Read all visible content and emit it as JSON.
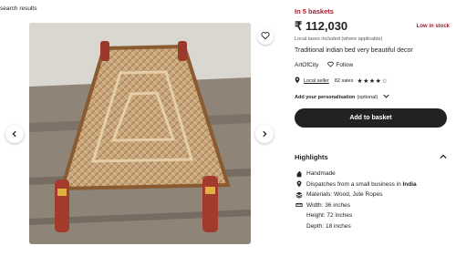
{
  "nav": {
    "back_link": "search results"
  },
  "product": {
    "in_baskets": "In 5 baskets",
    "price": "₹ 112,030",
    "stock_status": "Low in stock",
    "tax_note": "Local taxes included (where applicable)",
    "title": "Traditional indian bed very beautiful decor",
    "shop_name": "ArtOfCity",
    "follow_label": "Follow",
    "star_seller_label": "Local seller",
    "sales": "82 sales",
    "rating": 4,
    "rating_max": 5,
    "personalisation_label": "Add your personalisation",
    "personalisation_optional": "(optional)",
    "add_to_basket_label": "Add to basket"
  },
  "highlights": {
    "title": "Highlights",
    "handmade": "Handmade",
    "dispatch_prefix": "Dispatches from a small business in ",
    "dispatch_country": "India",
    "materials": "Materials: Wood, Jute Ropes",
    "width": "Width: 36 inches",
    "height": "Height: 72 inches",
    "depth": "Depth: 18 inches"
  },
  "colors": {
    "accent_red": "#a61a2e",
    "button_dark": "#222222",
    "text": "#222222"
  },
  "icons": [
    "chevron-left-icon",
    "chevron-right-icon",
    "heart-icon",
    "location-pin-icon",
    "star-icon",
    "chevron-down-icon",
    "chevron-up-icon",
    "hand-icon",
    "layers-icon",
    "ruler-icon"
  ]
}
